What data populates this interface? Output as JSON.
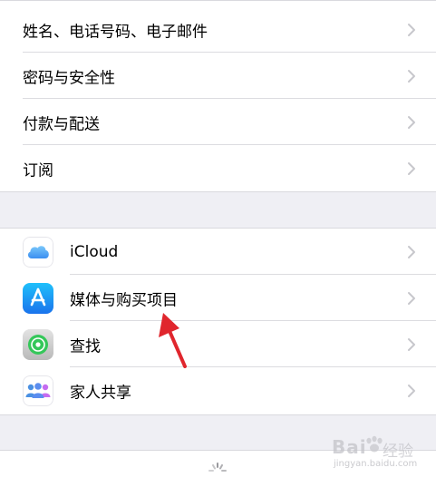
{
  "group1": {
    "rows": [
      {
        "label": "姓名、电话号码、电子邮件"
      },
      {
        "label": "密码与安全性"
      },
      {
        "label": "付款与配送"
      },
      {
        "label": "订阅"
      }
    ]
  },
  "group2": {
    "rows": [
      {
        "label": "iCloud",
        "icon": "icloud-icon"
      },
      {
        "label": "媒体与购买项目",
        "icon": "app-store-icon"
      },
      {
        "label": "查找",
        "icon": "find-my-icon"
      },
      {
        "label": "家人共享",
        "icon": "family-sharing-icon"
      }
    ]
  },
  "watermark": {
    "brand": "Bai",
    "suffix": "经验",
    "url": "jingyan.baidu.com"
  },
  "colors": {
    "background": "#efeff4",
    "chevron": "#c7c7cc",
    "separator": "#dcdce0",
    "arrow": "#e0262d"
  }
}
